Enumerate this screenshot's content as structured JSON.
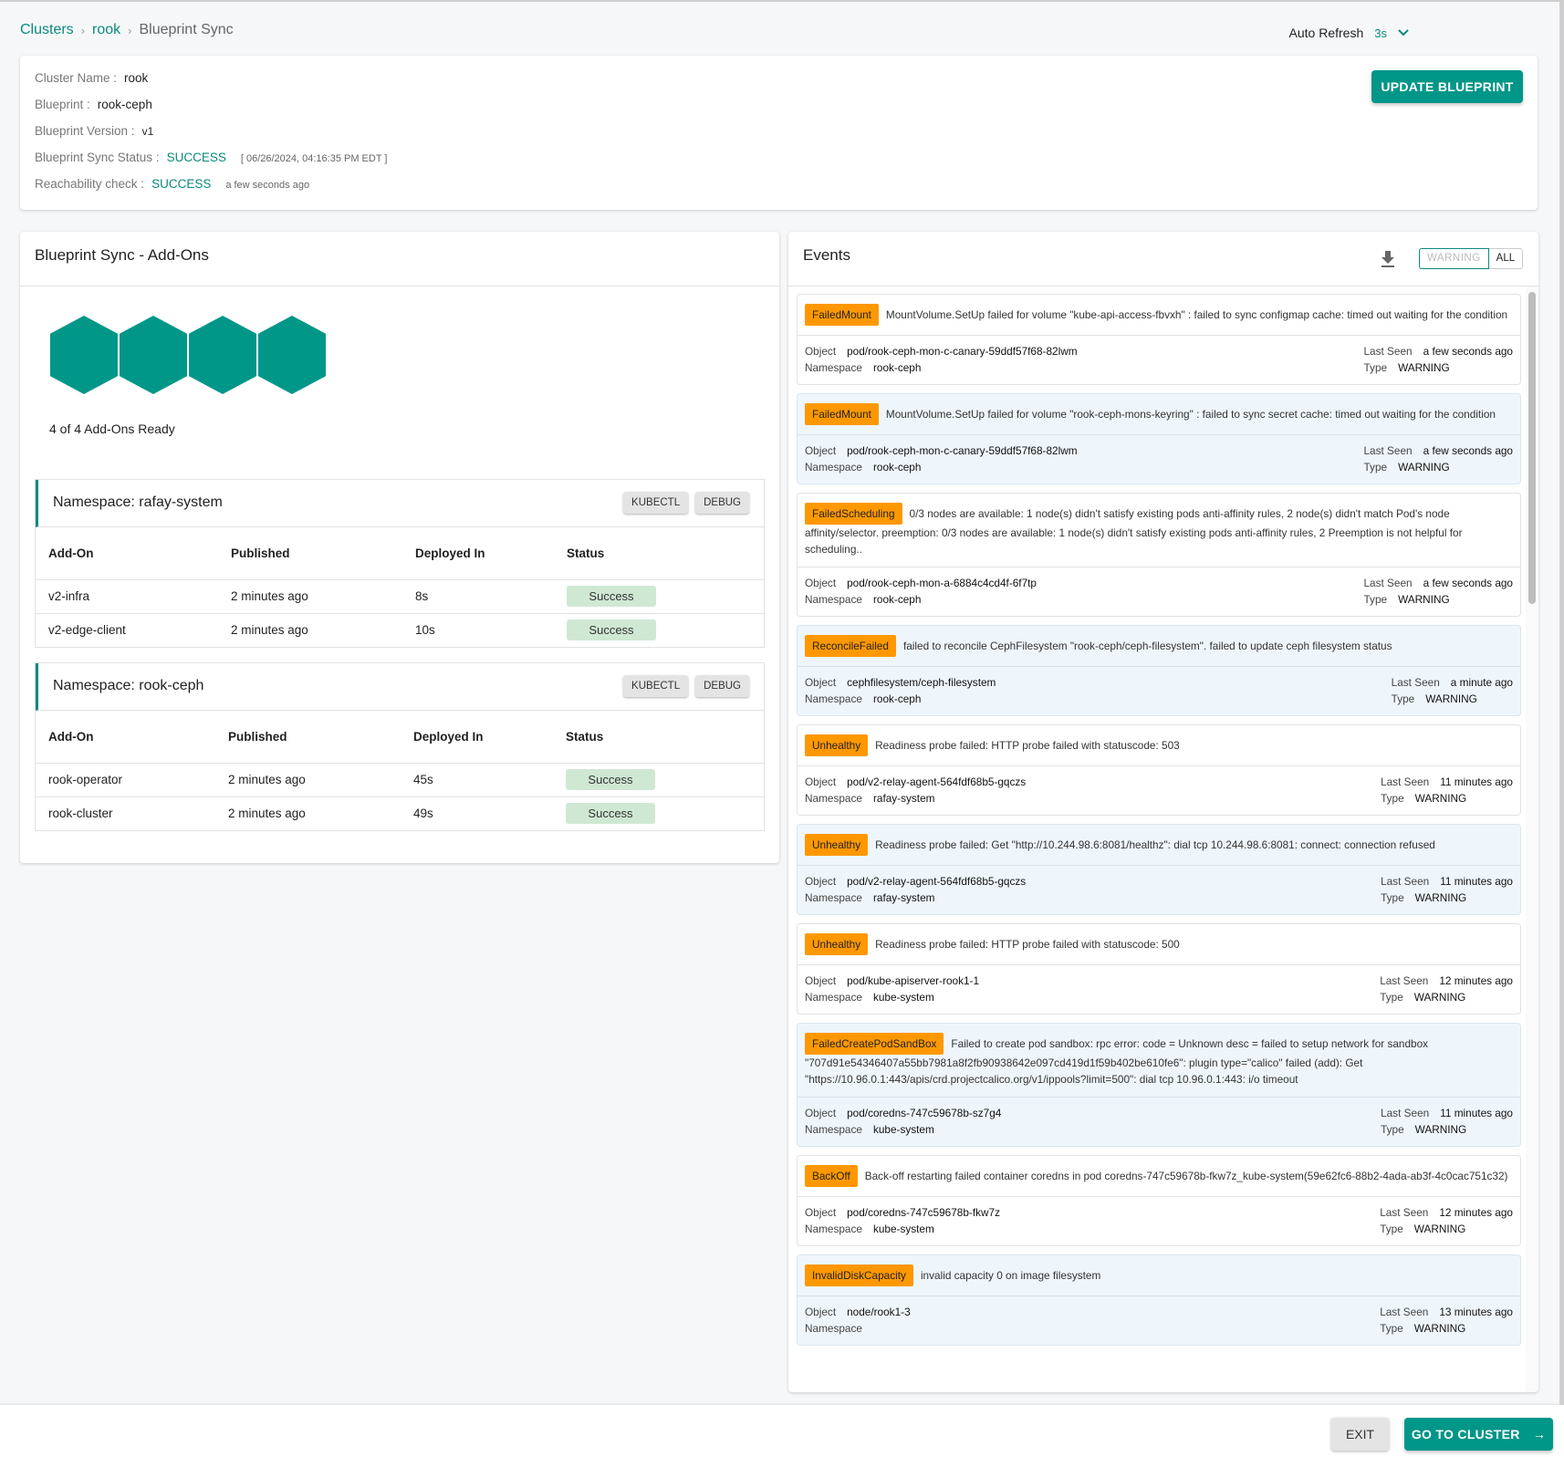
{
  "breadcrumb": {
    "items": [
      "Clusters",
      "rook",
      "Blueprint Sync"
    ],
    "separator": "›"
  },
  "auto_refresh": {
    "label": "Auto Refresh",
    "value": "3s"
  },
  "info": {
    "cluster_name_label": "Cluster Name :",
    "cluster_name": "rook",
    "blueprint_label": "Blueprint :",
    "blueprint": "rook-ceph",
    "version_label": "Blueprint Version :",
    "version": "v1",
    "sync_status_label": "Blueprint Sync Status :",
    "sync_status": "SUCCESS",
    "sync_time": "[ 06/26/2024, 04:16:35 PM EDT ]",
    "reachability_label": "Reachability check :",
    "reachability": "SUCCESS",
    "reachability_time": "a few seconds ago",
    "update_button": "UPDATE BLUEPRINT"
  },
  "addons": {
    "title": "Blueprint Sync - Add-Ons",
    "ready_count": 4,
    "total_count": 4,
    "ready_text": "4 of 4 Add-Ons Ready",
    "columns": [
      "Add-On",
      "Published",
      "Deployed In",
      "Status"
    ],
    "kubectl_label": "KUBECTL",
    "debug_label": "DEBUG",
    "namespaces": [
      {
        "title": "Namespace: rafay-system",
        "rows": [
          {
            "name": "v2-infra",
            "published": "2 minutes ago",
            "deployed_in": "8s",
            "status": "Success"
          },
          {
            "name": "v2-edge-client",
            "published": "2 minutes ago",
            "deployed_in": "10s",
            "status": "Success"
          }
        ]
      },
      {
        "title": "Namespace: rook-ceph",
        "rows": [
          {
            "name": "rook-operator",
            "published": "2 minutes ago",
            "deployed_in": "45s",
            "status": "Success"
          },
          {
            "name": "rook-cluster",
            "published": "2 minutes ago",
            "deployed_in": "49s",
            "status": "Success"
          }
        ]
      }
    ]
  },
  "events": {
    "title": "Events",
    "filter_options": [
      "WARNING",
      "ALL"
    ],
    "labels": {
      "object": "Object",
      "namespace": "Namespace",
      "last_seen": "Last Seen",
      "type": "Type"
    },
    "items": [
      {
        "reason": "FailedMount",
        "message": "MountVolume.SetUp failed for volume \"kube-api-access-fbvxh\" : failed to sync configmap cache: timed out waiting for the condition",
        "object": "pod/rook-ceph-mon-c-canary-59ddf57f68-82lwm",
        "namespace": "rook-ceph",
        "last_seen": "a few seconds ago",
        "type": "WARNING"
      },
      {
        "reason": "FailedMount",
        "message": "MountVolume.SetUp failed for volume \"rook-ceph-mons-keyring\" : failed to sync secret cache: timed out waiting for the condition",
        "object": "pod/rook-ceph-mon-c-canary-59ddf57f68-82lwm",
        "namespace": "rook-ceph",
        "last_seen": "a few seconds ago",
        "type": "WARNING"
      },
      {
        "reason": "FailedScheduling",
        "message": "0/3 nodes are available: 1 node(s) didn't satisfy existing pods anti-affinity rules, 2 node(s) didn't match Pod's node affinity/selector. preemption: 0/3 nodes are available: 1 node(s) didn't satisfy existing pods anti-affinity rules, 2 Preemption is not helpful for scheduling..",
        "object": "pod/rook-ceph-mon-a-6884c4cd4f-6f7tp",
        "namespace": "rook-ceph",
        "last_seen": "a few seconds ago",
        "type": "WARNING"
      },
      {
        "reason": "ReconcileFailed",
        "message": "failed to reconcile CephFilesystem \"rook-ceph/ceph-filesystem\". failed to update ceph filesystem status",
        "object": "cephfilesystem/ceph-filesystem",
        "namespace": "rook-ceph",
        "last_seen": "a minute ago",
        "type": "WARNING"
      },
      {
        "reason": "Unhealthy",
        "message": "Readiness probe failed: HTTP probe failed with statuscode: 503",
        "object": "pod/v2-relay-agent-564fdf68b5-gqczs",
        "namespace": "rafay-system",
        "last_seen": "11 minutes ago",
        "type": "WARNING"
      },
      {
        "reason": "Unhealthy",
        "message": "Readiness probe failed: Get \"http://10.244.98.6:8081/healthz\": dial tcp 10.244.98.6:8081: connect: connection refused",
        "object": "pod/v2-relay-agent-564fdf68b5-gqczs",
        "namespace": "rafay-system",
        "last_seen": "11 minutes ago",
        "type": "WARNING"
      },
      {
        "reason": "Unhealthy",
        "message": "Readiness probe failed: HTTP probe failed with statuscode: 500",
        "object": "pod/kube-apiserver-rook1-1",
        "namespace": "kube-system",
        "last_seen": "12 minutes ago",
        "type": "WARNING"
      },
      {
        "reason": "FailedCreatePodSandBox",
        "message": "Failed to create pod sandbox: rpc error: code = Unknown desc = failed to setup network for sandbox \"707d91e54346407a55bb7981a8f2fb90938642e097cd419d1f59b402be610fe6\": plugin type=\"calico\" failed (add): Get \"https://10.96.0.1:443/apis/crd.projectcalico.org/v1/ippools?limit=500\": dial tcp 10.96.0.1:443: i/o timeout",
        "object": "pod/coredns-747c59678b-sz7g4",
        "namespace": "kube-system",
        "last_seen": "11 minutes ago",
        "type": "WARNING"
      },
      {
        "reason": "BackOff",
        "message": "Back-off restarting failed container coredns in pod coredns-747c59678b-fkw7z_kube-system(59e62fc6-88b2-4ada-ab3f-4c0cac751c32)",
        "object": "pod/coredns-747c59678b-fkw7z",
        "namespace": "kube-system",
        "last_seen": "12 minutes ago",
        "type": "WARNING"
      },
      {
        "reason": "InvalidDiskCapacity",
        "message": "invalid capacity 0 on image filesystem",
        "object": "node/rook1-3",
        "namespace": "",
        "last_seen": "13 minutes ago",
        "type": "WARNING"
      }
    ]
  },
  "footer": {
    "exit_label": "EXIT",
    "go_label": "GO TO CLUSTER",
    "go_arrow": "→"
  },
  "colors": {
    "accent": "#009688",
    "link": "#0b8a7c",
    "reason_badge": "#ff9800",
    "success_pill": "#cfe8d3",
    "alt_event_bg": "#eef6fc"
  }
}
